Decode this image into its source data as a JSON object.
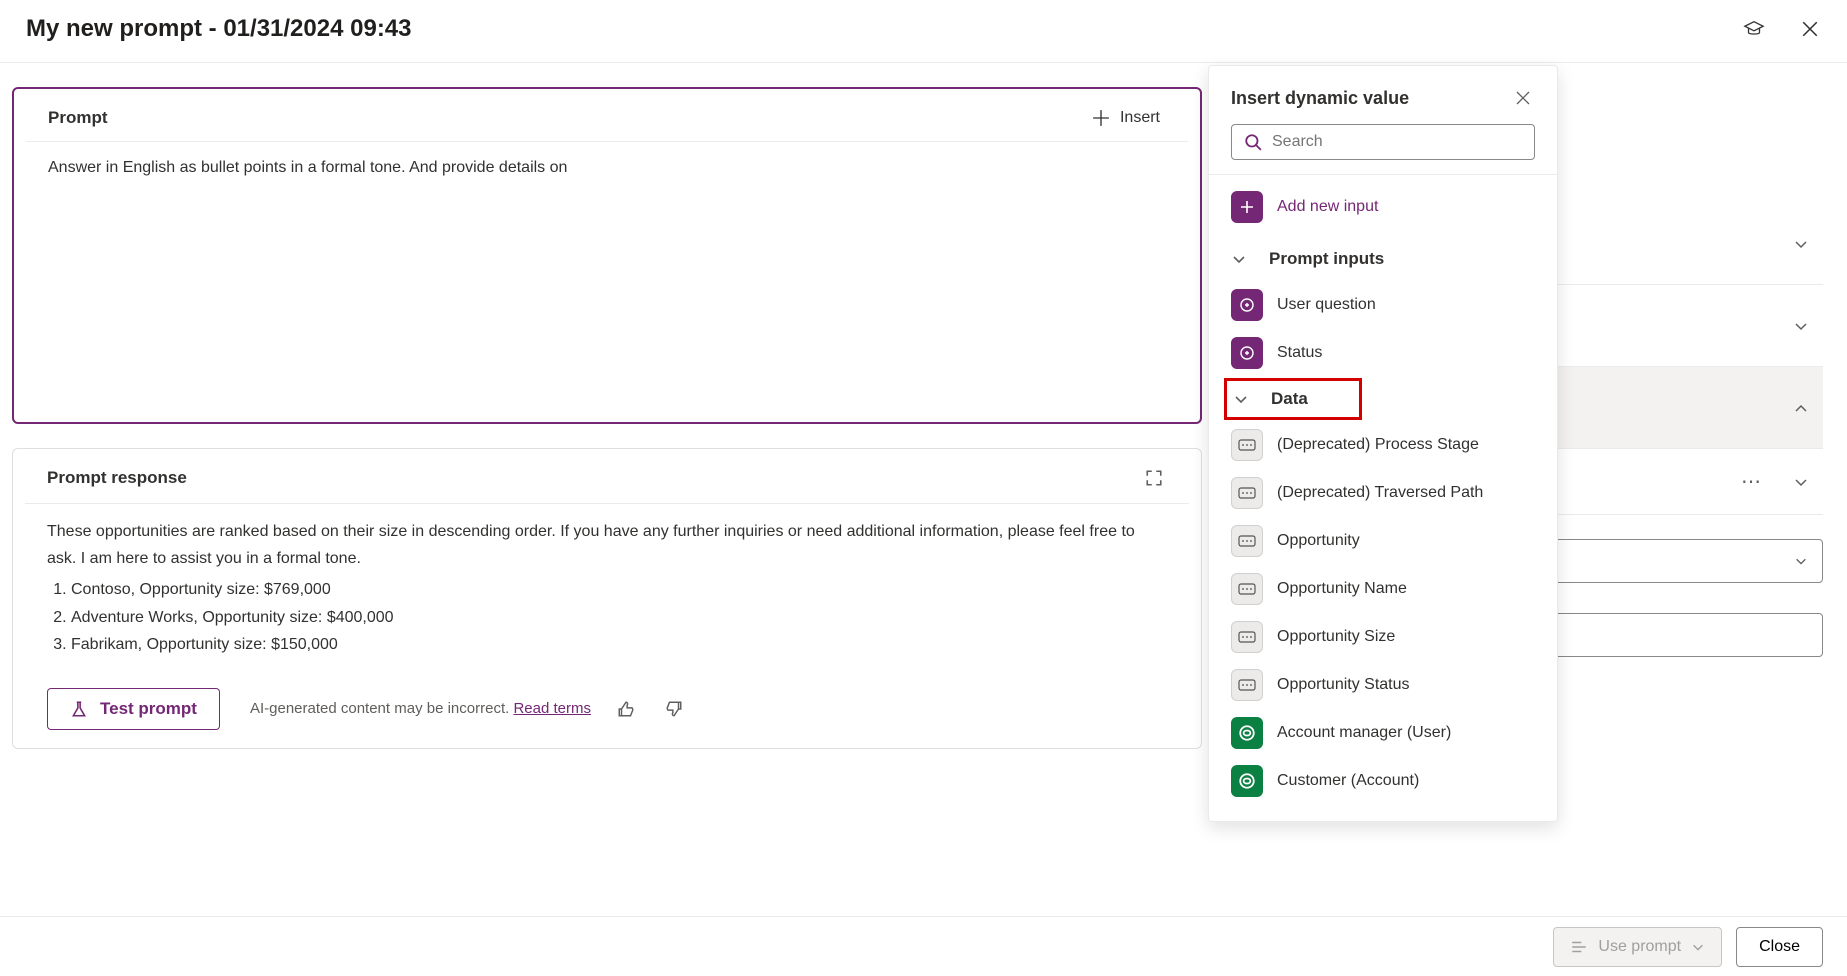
{
  "header": {
    "title": "My new prompt - 01/31/2024 09:43"
  },
  "prompt": {
    "section_label": "Prompt",
    "insert_label": "Insert",
    "text": "Answer in English as bullet points in a formal tone. And provide details on"
  },
  "response": {
    "section_label": "Prompt response",
    "intro": "These opportunities are ranked based on their size in descending order. If you have any further inquiries or need additional information, please feel free to ask. I am here to assist you in a formal tone.",
    "items": [
      "Contoso, Opportunity size: $769,000",
      "Adventure Works, Opportunity size: $400,000",
      "Fabrikam, Opportunity size: $150,000"
    ],
    "test_label": "Test prompt",
    "disclaimer": "AI-generated content may be incorrect.",
    "read_terms": "Read terms"
  },
  "dyn_panel": {
    "title": "Insert dynamic value",
    "search_placeholder": "Search",
    "add_input_label": "Add new input",
    "sections": {
      "prompt_inputs": "Prompt inputs",
      "data": "Data"
    },
    "prompt_input_items": [
      "User question",
      "Status"
    ],
    "data_items": [
      {
        "label": "(Deprecated) Process Stage",
        "tile": "gray"
      },
      {
        "label": "(Deprecated) Traversed Path",
        "tile": "gray"
      },
      {
        "label": "Opportunity",
        "tile": "gray"
      },
      {
        "label": "Opportunity Name",
        "tile": "gray"
      },
      {
        "label": "Opportunity Size",
        "tile": "gray"
      },
      {
        "label": "Opportunity Status",
        "tile": "gray"
      },
      {
        "label": "Account manager (User)",
        "tile": "green"
      },
      {
        "label": "Customer (Account)",
        "tile": "green"
      }
    ]
  },
  "footer": {
    "use_prompt": "Use prompt",
    "close": "Close"
  }
}
